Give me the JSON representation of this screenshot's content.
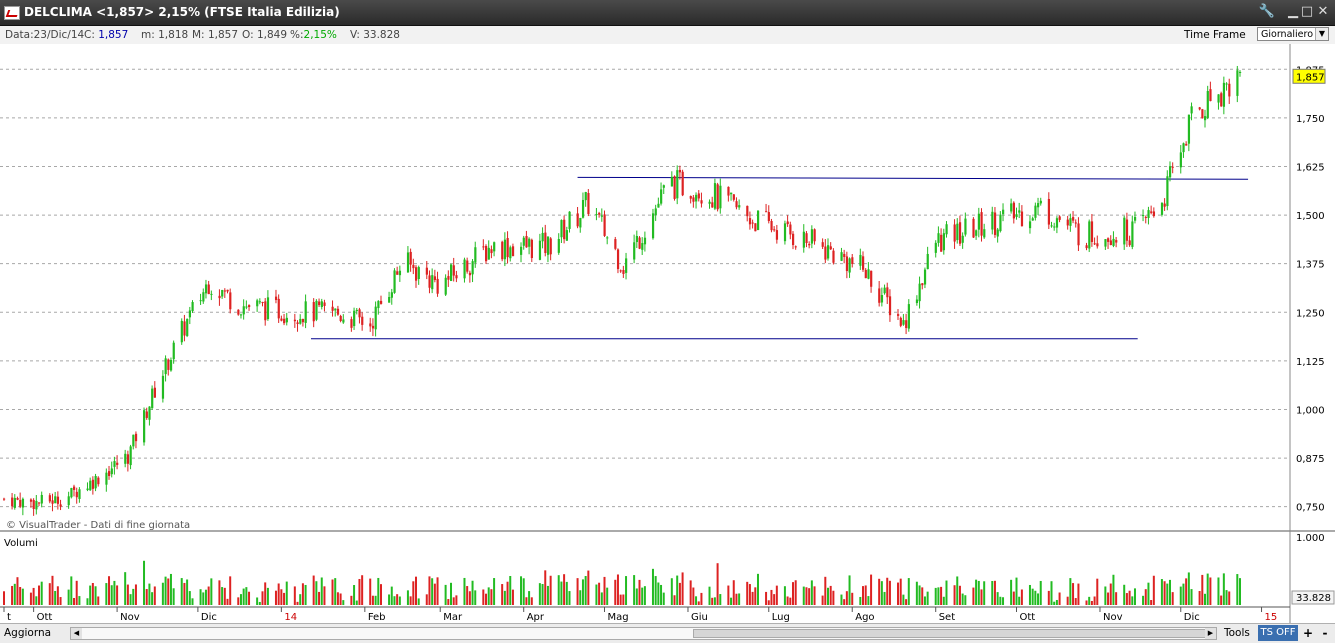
{
  "window": {
    "title": "DELCLIMA <1,857> 2,15%  (FTSE Italia Edilizia)",
    "controls": [
      "tools-icon",
      "minimize-icon",
      "maximize-icon",
      "close-icon"
    ]
  },
  "infobar": {
    "date_label": "Data:",
    "date_value": "23/Dic/14",
    "close_label": "C:",
    "close_value": "1,857",
    "min_label": "m:",
    "min_value": "1,818",
    "max_label": "M:",
    "max_value": "1,857",
    "open_label": "O:",
    "open_value": "1,849",
    "pct_label": "%:",
    "pct_value": "2,15%",
    "vol_label": "V:",
    "vol_value": "33.828",
    "timeframe_label": "Time Frame",
    "timeframe_value": "Giornaliero"
  },
  "chart_data": {
    "type": "candlestick",
    "price_axis": {
      "min": 0.69,
      "max": 1.94,
      "ticks": [
        "1,875",
        "1,750",
        "1,625",
        "1,500",
        "1,375",
        "1,250",
        "1,125",
        "1,000",
        "0,875",
        "0,750"
      ],
      "tick_values": [
        1.875,
        1.75,
        1.625,
        1.5,
        1.375,
        1.25,
        1.125,
        1.0,
        0.875,
        0.75
      ],
      "grid": true,
      "position": "right"
    },
    "last_price": {
      "label": "1,857",
      "value": 1.857,
      "color": "#ffff00"
    },
    "x_labels": [
      "t",
      "Ott",
      "Nov",
      "Dic",
      "14",
      "Feb",
      "Mar",
      "Apr",
      "Mag",
      "Giu",
      "Lug",
      "Ago",
      "Set",
      "Ott",
      "Nov",
      "Dic",
      "15"
    ],
    "x_label_colors": {
      "14": "#cc0000",
      "15": "#cc0000"
    },
    "price_path": [
      [
        "2013-09-20",
        0.77
      ],
      [
        "2013-10-01",
        0.76
      ],
      [
        "2013-10-12",
        0.77
      ],
      [
        "2013-10-24",
        0.82
      ],
      [
        "2013-11-05",
        0.88
      ],
      [
        "2013-11-15",
        1.05
      ],
      [
        "2013-11-25",
        1.2
      ],
      [
        "2013-12-05",
        1.33
      ],
      [
        "2013-12-16",
        1.27
      ],
      [
        "2014-01-05",
        1.25
      ],
      [
        "2014-01-20",
        1.25
      ],
      [
        "2014-02-03",
        1.22
      ],
      [
        "2014-02-15",
        1.38
      ],
      [
        "2014-03-01",
        1.32
      ],
      [
        "2014-03-20",
        1.42
      ],
      [
        "2014-04-10",
        1.42
      ],
      [
        "2014-04-25",
        1.53
      ],
      [
        "2014-05-08",
        1.37
      ],
      [
        "2014-05-25",
        1.58
      ],
      [
        "2014-06-05",
        1.57
      ],
      [
        "2014-06-25",
        1.49
      ],
      [
        "2014-07-20",
        1.42
      ],
      [
        "2014-08-05",
        1.36
      ],
      [
        "2014-08-20",
        1.22
      ],
      [
        "2014-09-01",
        1.43
      ],
      [
        "2014-09-20",
        1.48
      ],
      [
        "2014-10-10",
        1.52
      ],
      [
        "2014-10-25",
        1.45
      ],
      [
        "2014-11-15",
        1.46
      ],
      [
        "2014-11-25",
        1.55
      ],
      [
        "2014-12-05",
        1.75
      ],
      [
        "2014-12-15",
        1.82
      ],
      [
        "2014-12-23",
        1.857
      ]
    ],
    "trendlines": [
      {
        "from": [
          "2014-01-12",
          1.182
        ],
        "to": [
          "2014-11-15",
          1.182
        ],
        "color": "#00008b"
      },
      {
        "from": [
          "2014-04-21",
          1.597
        ],
        "to": [
          "2014-12-26",
          1.592
        ],
        "color": "#00008b"
      }
    ],
    "volume_panel": {
      "title": "Volumi",
      "max_label": "1.000",
      "last_label": "33.828"
    },
    "watermark": "© VisualTrader - Dati di fine giornata"
  },
  "bottombar": {
    "refresh_label": "Aggiorna",
    "tools_label": "Tools",
    "ts_label": "TS OFF",
    "plus_label": "+",
    "minus_label": "-"
  }
}
